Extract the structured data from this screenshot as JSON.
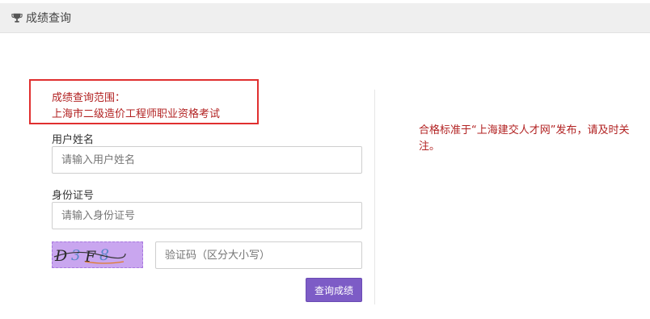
{
  "header": {
    "title": "成绩查询",
    "icon": "trophy-icon"
  },
  "scope": {
    "heading": "成绩查询范围：",
    "exam": "上海市二级造价工程师职业资格考试"
  },
  "form": {
    "name_label": "用户姓名",
    "name_placeholder": "请输入用户姓名",
    "id_label": "身份证号",
    "id_placeholder": "请输入身份证号",
    "captcha_text": "D3F8",
    "code_placeholder": "验证码（区分大小写）",
    "submit_label": "查询成绩"
  },
  "notice": {
    "text": "合格标准于“上海建交人才网”发布，请及时关注。"
  },
  "colors": {
    "accent": "#7d5cc6",
    "highlight_border": "#e02f2f",
    "notice_text": "#b22222"
  }
}
